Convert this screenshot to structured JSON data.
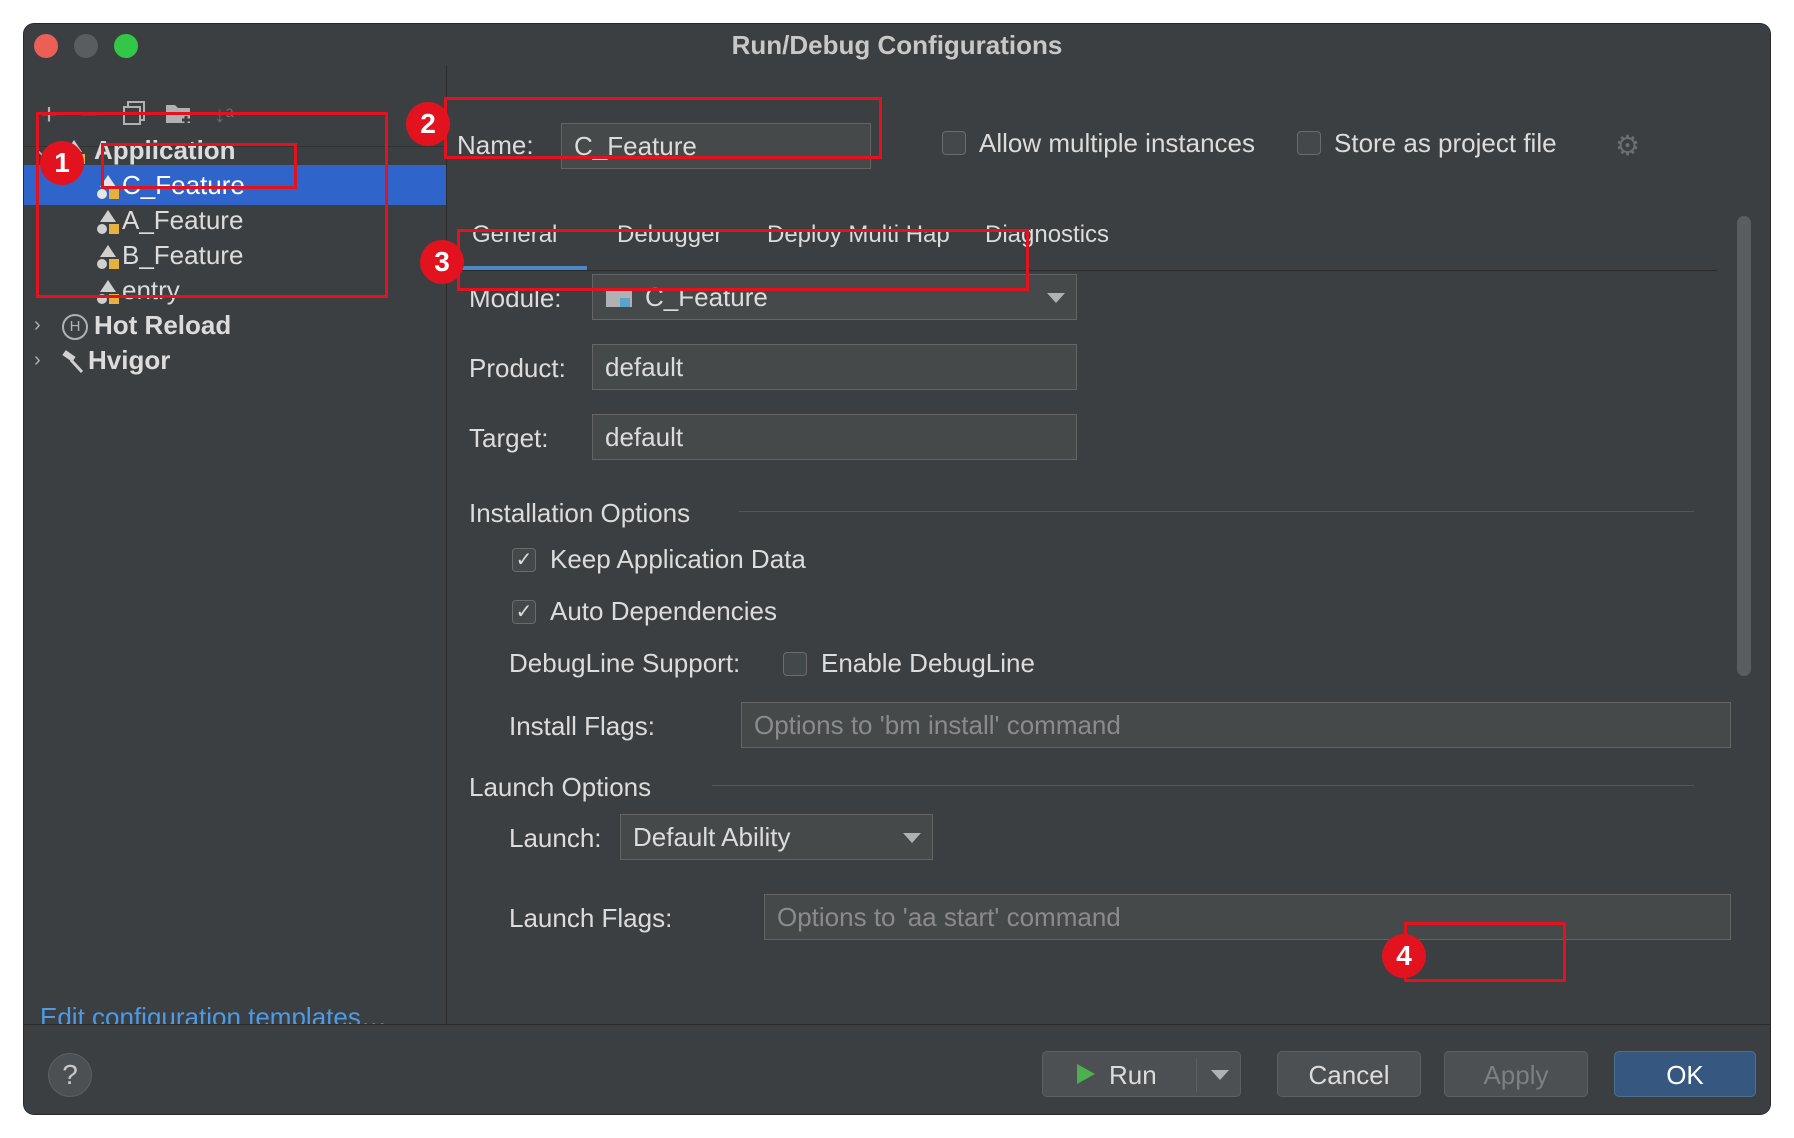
{
  "window": {
    "title": "Run/Debug Configurations"
  },
  "sidebar": {
    "tree": [
      {
        "label": "Application",
        "expanded": true
      },
      {
        "label": "C_Feature",
        "selected": true
      },
      {
        "label": "A_Feature"
      },
      {
        "label": "B_Feature"
      },
      {
        "label": "entry"
      },
      {
        "label": "Hot Reload",
        "expanded": false
      },
      {
        "label": "Hvigor",
        "expanded": false
      }
    ],
    "edit_templates_link": "Edit configuration templates…"
  },
  "header": {
    "name_label": "Name:",
    "name_value": "C_Feature",
    "allow_multiple_label": "Allow multiple instances",
    "store_project_label": "Store as project file"
  },
  "tabs": [
    {
      "label": "General",
      "active": true
    },
    {
      "label": "Debugger"
    },
    {
      "label": "Deploy Multi Hap"
    },
    {
      "label": "Diagnostics"
    }
  ],
  "general": {
    "module_label": "Module:",
    "module_value": "C_Feature",
    "product_label": "Product:",
    "product_value": "default",
    "target_label": "Target:",
    "target_value": "default",
    "installation_title": "Installation Options",
    "keep_data_label": "Keep Application Data",
    "keep_data_checked": true,
    "auto_deps_label": "Auto Dependencies",
    "auto_deps_checked": true,
    "debugline_label": "DebugLine Support:",
    "enable_debugline_label": "Enable DebugLine",
    "enable_debugline_checked": false,
    "install_flags_label": "Install Flags:",
    "install_flags_placeholder": "Options to 'bm install' command",
    "launch_title": "Launch Options",
    "launch_label": "Launch:",
    "launch_value": "Default Ability",
    "launch_flags_label": "Launch Flags:",
    "launch_flags_placeholder": "Options to 'aa start' command"
  },
  "footer": {
    "help": "?",
    "run": "Run",
    "cancel": "Cancel",
    "apply": "Apply",
    "ok": "OK"
  },
  "annotations": {
    "badge1": "1",
    "badge2": "2",
    "badge3": "3",
    "badge4": "4"
  },
  "colors": {
    "accent": "#2f65ca",
    "annotation": "#e3121f",
    "link": "#4b9be8"
  }
}
